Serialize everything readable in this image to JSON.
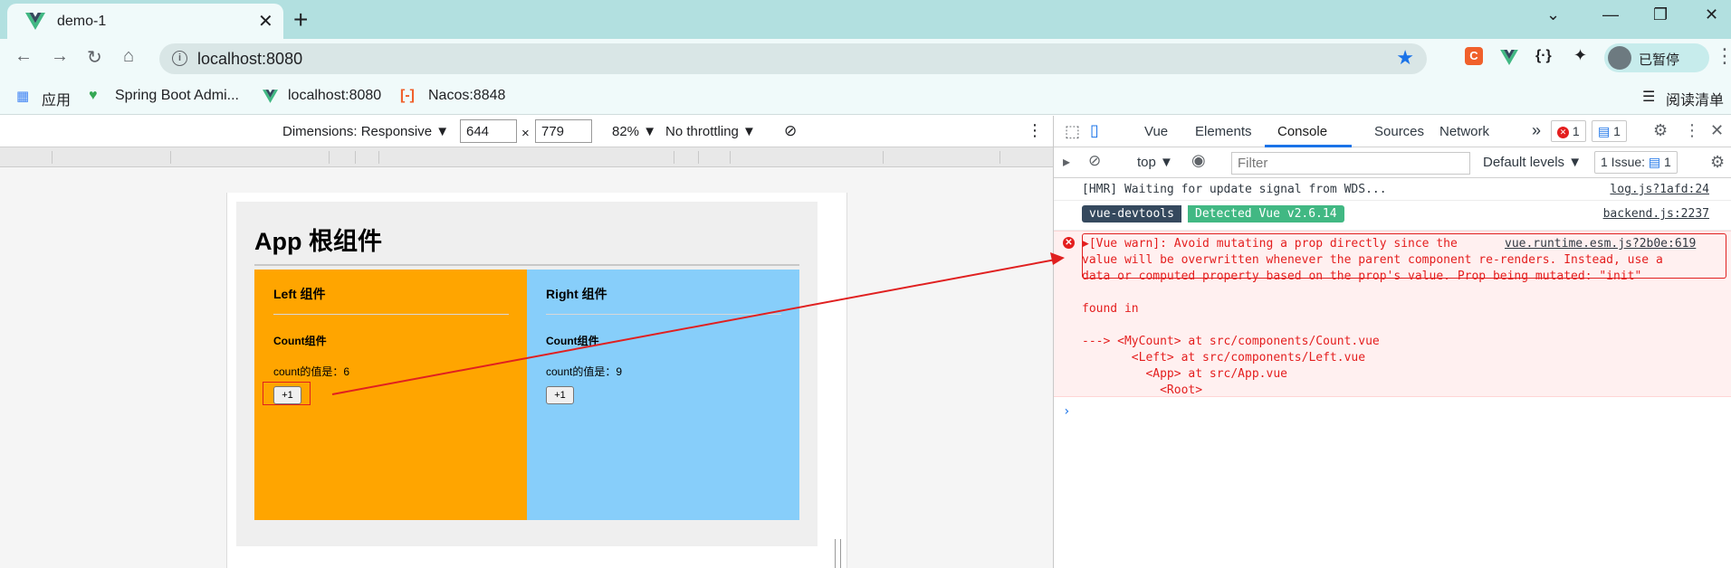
{
  "browser": {
    "tab_title": "demo-1",
    "tab_close": "✕",
    "new_tab": "+",
    "url": "localhost:8080",
    "profile_label": "已暂停",
    "bookmarks": [
      "应用",
      "Spring Boot Admi...",
      "localhost:8080",
      "Nacos:8848"
    ],
    "reading_list": "阅读清单",
    "window_controls": [
      "⌄",
      "—",
      "❐",
      "✕"
    ]
  },
  "device_toolbar": {
    "dimensions_label": "Dimensions: Responsive ▼",
    "width": "644",
    "times": "×",
    "height": "779",
    "zoom": "82% ▼",
    "throttling": "No throttling ▼"
  },
  "app": {
    "title": "App 根组件",
    "left": {
      "title": "Left 组件",
      "count_title": "Count组件",
      "count_value_label": "count的值是：6",
      "button": "+1"
    },
    "right": {
      "title": "Right 组件",
      "count_title": "Count组件",
      "count_value_label": "count的值是：9",
      "button": "+1"
    }
  },
  "devtools": {
    "tabs": [
      "Vue",
      "Elements",
      "Console",
      "Sources",
      "Network"
    ],
    "active_tab": "Console",
    "more_tabs": "»",
    "error_badge": "1",
    "message_badge": "1",
    "context": "top ▼",
    "filter_placeholder": "Filter",
    "levels": "Default levels ▼",
    "issues_label": "1 Issue:",
    "issues_count": "1",
    "console": {
      "hmr_msg": "[HMR] Waiting for update signal from WDS...",
      "hmr_src": "log.js?1afd:24",
      "devtools_pill": "vue-devtools",
      "detected_pill": "Detected Vue v2.6.14",
      "devtools_src": "backend.js:2237",
      "warn_line1": "▶[Vue warn]: Avoid mutating a prop directly since the",
      "warn_src": "vue.runtime.esm.js?2b0e:619",
      "warn_line2": "value will be overwritten whenever the parent component re-renders. Instead, use a",
      "warn_line3": "data or computed property based on the prop's value. Prop being mutated: \"init\"",
      "found_in": "found in",
      "trace1": "---> <MyCount> at src/components/Count.vue",
      "trace2": "       <Left> at src/components/Left.vue",
      "trace3": "         <App> at src/App.vue",
      "trace4": "           <Root>",
      "prompt": "›"
    }
  },
  "colors": {
    "left_pane": "#ffa500",
    "right_pane": "#87cefa",
    "error_red": "#e41e1e",
    "accent_blue": "#1a73e8",
    "vue_green": "#41b883"
  }
}
